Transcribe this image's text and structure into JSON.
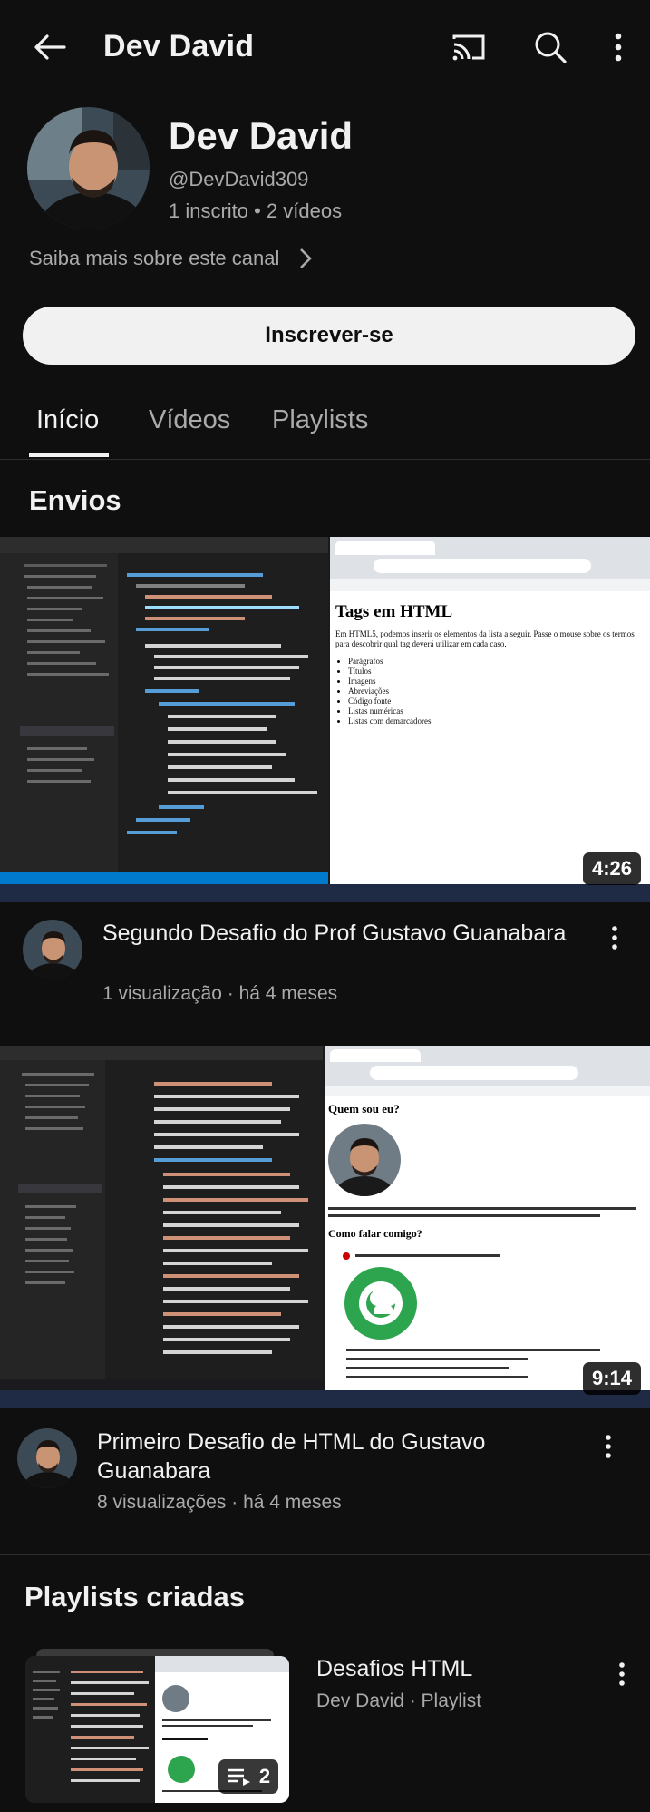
{
  "header": {
    "title": "Dev David",
    "icons": [
      "back-arrow-icon",
      "cast-icon",
      "search-icon",
      "more-vert-icon"
    ]
  },
  "channel": {
    "name": "Dev David",
    "handle": "@DevDavid309",
    "stats": "1 inscrito • 2 vídeos",
    "about_link": "Saiba mais sobre este canal",
    "subscribe_label": "Inscrever-se"
  },
  "tabs": [
    {
      "label": "Início",
      "active": true
    },
    {
      "label": "Vídeos",
      "active": false
    },
    {
      "label": "Playlists",
      "active": false
    }
  ],
  "uploads": {
    "heading": "Envios",
    "videos": [
      {
        "title": "Segundo Desafio do Prof Gustavo Guanabara",
        "meta": "1 visualização · há 4 meses",
        "duration": "4:26",
        "thumb_heading": "Tags em HTML",
        "thumb_body": "Em HTML5, podemos inserir os elementos da lista a seguir. Passe o mouse sobre os termos para descobrir qual tag deverá utilizar em cada caso.",
        "thumb_list": [
          "Parágrafos",
          "Títulos",
          "Imagens",
          "Abreviações",
          "Código fonte",
          "Listas numéricas",
          "Listas com demarcadores"
        ]
      },
      {
        "title": "Primeiro Desafio de HTML do Gustavo Guanabara",
        "meta": "8 visualizações · há 4 meses",
        "duration": "9:14",
        "thumb_heading": "Quem sou eu?",
        "thumb_heading2": "Como falar comigo?"
      }
    ]
  },
  "playlists": {
    "heading": "Playlists criadas",
    "items": [
      {
        "title": "Desafios HTML",
        "meta": "Dev David · Playlist",
        "count": "2"
      }
    ]
  },
  "colors": {
    "background": "#0f0f0f",
    "text": "#f1f1f1",
    "muted": "#aaaaaa",
    "subscribe_bg": "#f1f1f1",
    "subscribe_text": "#0f0f0f",
    "vscode": "#1e1e1e",
    "taskbar": "#1f2a44"
  }
}
